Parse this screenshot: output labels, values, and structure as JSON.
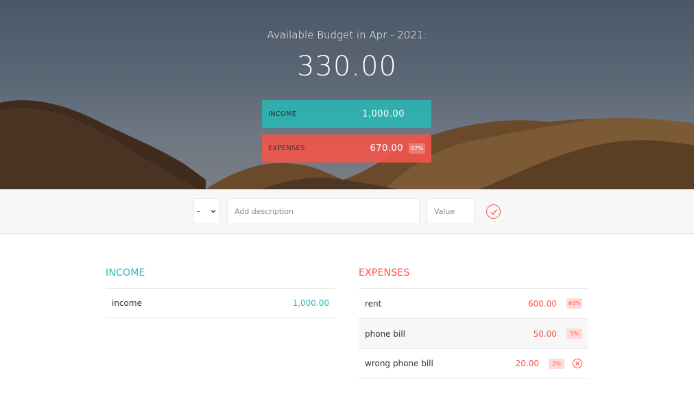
{
  "header": {
    "title": "Available Budget in Apr - 2021:",
    "budget": "330.00",
    "income": {
      "label": "Income",
      "value": "1,000.00"
    },
    "expenses": {
      "label": "Expenses",
      "value": "670.00",
      "percentage": "67%"
    }
  },
  "add_form": {
    "type_selected": "-",
    "description_placeholder": "Add description",
    "value_placeholder": "Value",
    "submit_icon": "checkmark-icon"
  },
  "income_list": {
    "title": "Income",
    "items": [
      {
        "description": "income",
        "value": "1,000.00"
      }
    ]
  },
  "expenses_list": {
    "title": "Expenses",
    "items": [
      {
        "description": "rent",
        "value": "600.00",
        "percentage": "60%"
      },
      {
        "description": "phone bill",
        "value": "50.00",
        "percentage": "5%"
      },
      {
        "description": "wrong phone bill",
        "value": "20.00",
        "percentage": "2%"
      }
    ]
  },
  "colors": {
    "income": "#28b9b5",
    "expenses": "#ff5049",
    "form_background": "#f7f7f7"
  }
}
